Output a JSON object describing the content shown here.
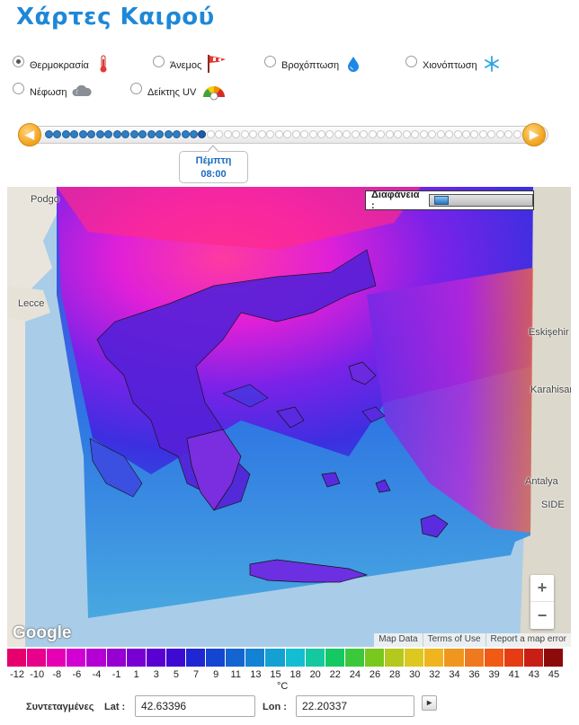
{
  "page": {
    "title": "Χάρτες Καιρού"
  },
  "layers": [
    {
      "label": "Θερμοκρασία",
      "icon": "thermometer-icon",
      "selected": true
    },
    {
      "label": "Άνεμος",
      "icon": "wind-flag-icon",
      "selected": false
    },
    {
      "label": "Βροχόπτωση",
      "icon": "raindrop-icon",
      "selected": false
    },
    {
      "label": "Χιονόπτωση",
      "icon": "snowflake-icon",
      "selected": false
    },
    {
      "label": "Νέφωση",
      "icon": "cloud-icon",
      "selected": false
    },
    {
      "label": "Δείκτης UV",
      "icon": "uv-sun-icon",
      "selected": false
    }
  ],
  "timeline": {
    "day": "Πέμπτη",
    "time": "08:00",
    "prev_icon": "prev-arrow-icon",
    "next_icon": "next-arrow-icon",
    "total_steps": 56,
    "current_step": 19
  },
  "map": {
    "opacity_label": "Διαφάνεια :",
    "opacity_value": 0.05,
    "places": [
      "Podgo",
      "Lecce",
      "Eskişehir",
      "Karahisar",
      "Antalya",
      "SIDE"
    ],
    "zoom_in": "+",
    "zoom_out": "−",
    "brand": "Google",
    "links": [
      "Map Data",
      "Terms of Use",
      "Report a map error"
    ]
  },
  "legend": {
    "values": [
      "-12",
      "-10",
      "-8",
      "-6",
      "-4",
      "-1",
      "1",
      "3",
      "5",
      "7",
      "9",
      "11",
      "13",
      "15",
      "18",
      "20",
      "22",
      "24",
      "26",
      "28",
      "30",
      "32",
      "34",
      "36",
      "39",
      "41",
      "43",
      "45"
    ],
    "colors": [
      "#e6006e",
      "#e6008c",
      "#e600b4",
      "#d200d2",
      "#b400d2",
      "#9600d2",
      "#7800d2",
      "#5a00d2",
      "#3c0ad2",
      "#1e28d2",
      "#1446d2",
      "#1464d2",
      "#1482d2",
      "#14a0d2",
      "#14bed2",
      "#14c8a0",
      "#14c864",
      "#3cc83c",
      "#78c81e",
      "#b4c81e",
      "#dcc81e",
      "#f0b41e",
      "#f0961e",
      "#f0781e",
      "#f05a14",
      "#e63c14",
      "#c81e14",
      "#8c0a0a"
    ],
    "unit": "°C"
  },
  "coords": {
    "label": "Συντεταγμένες",
    "lat_label": "Lat :",
    "lat_value": "42.63396",
    "lon_label": "Lon :",
    "lon_value": "22.20337",
    "go_icon": "go-arrow-icon"
  }
}
